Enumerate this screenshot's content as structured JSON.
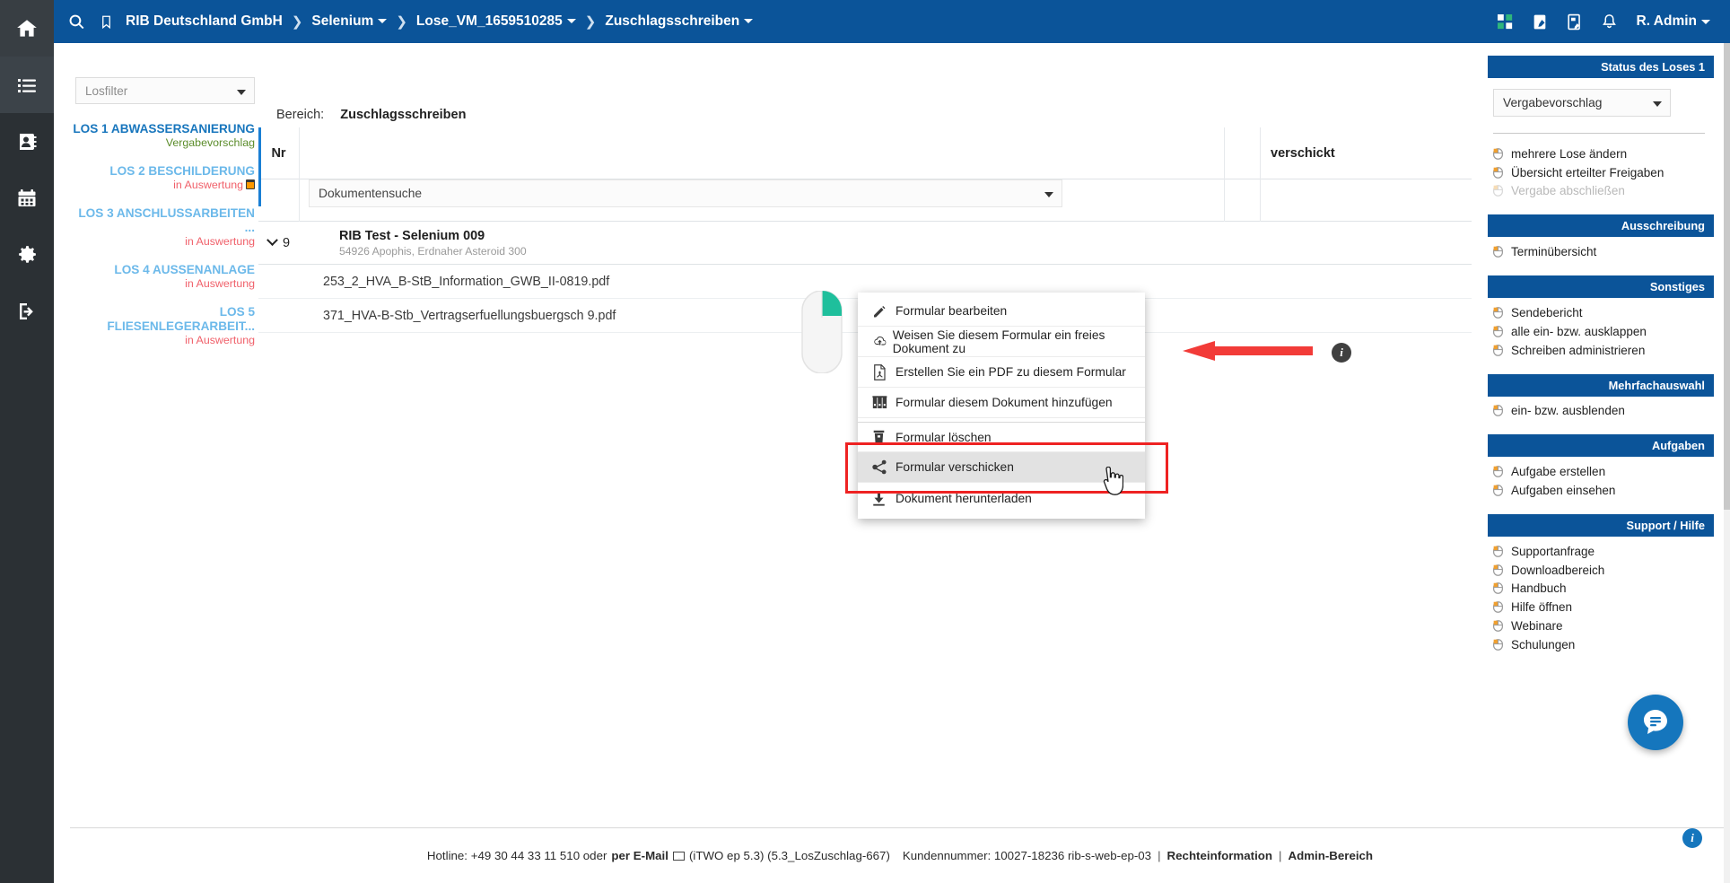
{
  "topbar": {
    "search_icon": "search-icon",
    "bookmark_icon": "bookmark-icon",
    "breadcrumbs": [
      {
        "label": "RIB Deutschland GmbH",
        "dropdown": false
      },
      {
        "label": "Selenium",
        "dropdown": true
      },
      {
        "label": "Lose_VM_1659510285",
        "dropdown": true
      },
      {
        "label": "Zuschlagsschreiben",
        "dropdown": true
      }
    ],
    "icons": [
      "apps-grid-icon",
      "clipboard-edit-icon",
      "note-edit-icon",
      "bell-icon"
    ],
    "user": "R. Admin"
  },
  "rail": {
    "items": [
      "home-icon",
      "list-icon",
      "contacts-icon",
      "calendar-icon",
      "settings-icon",
      "logout-icon"
    ]
  },
  "left_panel": {
    "filter_placeholder": "Losfilter",
    "lots": [
      {
        "name": "LOS 1 ABWASSERSANIERUNG",
        "status": "Vergabevorschlag",
        "active": true,
        "calendar": false
      },
      {
        "name": "LOS 2 BESCHILDERUNG",
        "status": "in Auswertung",
        "active": false,
        "calendar": true
      },
      {
        "name": "LOS 3 ANSCHLUSSARBEITEN ...",
        "status": "in Auswertung",
        "active": false,
        "calendar": false
      },
      {
        "name": "LOS 4 AUSSENANLAGE",
        "status": "in Auswertung",
        "active": false,
        "calendar": false
      },
      {
        "name": "LOS 5 FLIESENLEGERARBEIT...",
        "status": "in Auswertung",
        "active": false,
        "calendar": false
      }
    ]
  },
  "main": {
    "bereich_label": "Bereich:",
    "bereich_value": "Zuschlagsschreiben",
    "col_nr": "Nr",
    "col_sent": "verschickt",
    "doc_search": "Dokumentensuche",
    "group": {
      "number": "9",
      "title": "RIB Test - Selenium 009",
      "subtitle": "54926 Apophis, Erdnaher Asteroid 300"
    },
    "files": [
      "253_2_HVA_B-StB_Information_GWB_II-0819.pdf",
      "371_HVA-B-Stb_Vertragserfuellungsbuergsch                9.pdf"
    ],
    "info_badge": "i"
  },
  "context_menu": {
    "items": [
      {
        "label": "Formular bearbeiten",
        "icon": "pencil-icon",
        "highlighted": false,
        "separator_before": false
      },
      {
        "label": "Weisen Sie diesem Formular ein freies Dokument zu",
        "icon": "cloud-upload-icon",
        "highlighted": false,
        "separator_before": false
      },
      {
        "label": "Erstellen Sie ein PDF zu diesem Formular",
        "icon": "pdf-file-icon",
        "highlighted": false,
        "separator_before": false
      },
      {
        "label": "Formular diesem Dokument hinzufügen",
        "icon": "binders-icon",
        "highlighted": false,
        "separator_before": false
      },
      {
        "label": "Formular löschen",
        "icon": "trash-icon",
        "highlighted": false,
        "separator_before": true
      },
      {
        "label": "Formular verschicken",
        "icon": "share-icon",
        "highlighted": true,
        "separator_before": false
      },
      {
        "label": "Dokument herunterladen",
        "icon": "download-icon",
        "highlighted": false,
        "separator_before": false
      }
    ]
  },
  "right_panel": {
    "sections": [
      {
        "title": "Status des Loses 1",
        "select_value": "Vergabevorschlag",
        "divider": true,
        "items": [
          {
            "label": "mehrere Lose ändern",
            "disabled": false
          },
          {
            "label": "Übersicht erteilter Freigaben",
            "disabled": false
          },
          {
            "label": "Vergabe abschließen",
            "disabled": true
          }
        ]
      },
      {
        "title": "Ausschreibung",
        "items": [
          {
            "label": "Terminübersicht",
            "disabled": false
          }
        ]
      },
      {
        "title": "Sonstiges",
        "items": [
          {
            "label": "Sendebericht",
            "disabled": false
          },
          {
            "label": "alle ein- bzw. ausklappen",
            "disabled": false
          },
          {
            "label": "Schreiben administrieren",
            "disabled": false
          }
        ]
      },
      {
        "title": "Mehrfachauswahl",
        "items": [
          {
            "label": "ein- bzw. ausblenden",
            "disabled": false
          }
        ]
      },
      {
        "title": "Aufgaben",
        "items": [
          {
            "label": "Aufgabe erstellen",
            "disabled": false
          },
          {
            "label": "Aufgaben einsehen",
            "disabled": false
          }
        ]
      },
      {
        "title": "Support / Hilfe",
        "items": [
          {
            "label": "Supportanfrage",
            "disabled": false
          },
          {
            "label": "Downloadbereich",
            "disabled": false
          },
          {
            "label": "Handbuch",
            "disabled": false
          },
          {
            "label": "Hilfe öffnen",
            "disabled": false
          },
          {
            "label": "Webinare",
            "disabled": false
          },
          {
            "label": "Schulungen",
            "disabled": false
          }
        ]
      }
    ],
    "info_badge": "i"
  },
  "footer": {
    "hotline": "Hotline: +49 30 44 33 11 510 oder",
    "email_link": "per E-Mail",
    "version": "(iTWO ep 5.3) (5.3_LosZuschlag-667)",
    "customer": "Kundennummer: 10027-18236 rib-s-web-ep-03",
    "legal": "Rechteinformation",
    "admin": "Admin-Bereich",
    "sep": "|"
  },
  "colors": {
    "brand_blue": "#0b5499",
    "accent_blue": "#1a7fd4",
    "rail_dark": "#2b3034",
    "status_green": "#5b8c2a",
    "status_red": "#f0606a",
    "lot_link": "#6cb9ea",
    "highlight_red": "#ee2222",
    "teal": "#1fbf9c"
  }
}
